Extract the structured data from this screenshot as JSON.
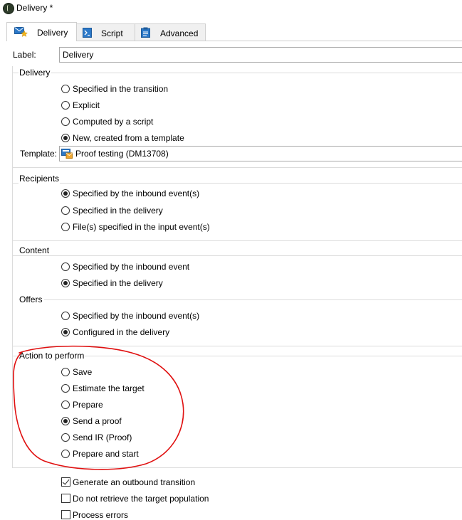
{
  "window": {
    "title": "Delivery *"
  },
  "tabs": [
    {
      "label": "Delivery",
      "icon": "delivery-envelope-icon",
      "active": true
    },
    {
      "label": "Script",
      "icon": "script-icon",
      "active": false
    },
    {
      "label": "Advanced",
      "icon": "advanced-clipboard-icon",
      "active": false
    }
  ],
  "label_field": {
    "label": "Label:",
    "value": "Delivery"
  },
  "delivery_group": {
    "title": "Delivery",
    "options": [
      {
        "label": "Specified in the transition",
        "selected": false
      },
      {
        "label": "Explicit",
        "selected": false
      },
      {
        "label": "Computed by a script",
        "selected": false
      },
      {
        "label": "New, created from a template",
        "selected": true
      }
    ],
    "template_label": "Template:",
    "template_value": "Proof testing (DM13708)"
  },
  "recipients_group": {
    "title": "Recipients",
    "options": [
      {
        "label": "Specified by the inbound event(s)",
        "selected": true
      },
      {
        "label": "Specified in the delivery",
        "selected": false
      },
      {
        "label": "File(s) specified in the input event(s)",
        "selected": false
      }
    ]
  },
  "content_group": {
    "title": "Content",
    "options": [
      {
        "label": "Specified by the inbound event",
        "selected": false
      },
      {
        "label": "Specified in the delivery",
        "selected": true
      }
    ]
  },
  "offers_group": {
    "title": "Offers",
    "options": [
      {
        "label": "Specified by the inbound event(s)",
        "selected": false
      },
      {
        "label": "Configured in the delivery",
        "selected": true
      }
    ]
  },
  "action_group": {
    "title": "Action to perform",
    "options": [
      {
        "label": "Save",
        "selected": false
      },
      {
        "label": "Estimate the target",
        "selected": false
      },
      {
        "label": "Prepare",
        "selected": false
      },
      {
        "label": "Send a proof",
        "selected": true
      },
      {
        "label": "Send IR (Proof)",
        "selected": false
      },
      {
        "label": "Prepare and start",
        "selected": false
      }
    ],
    "annotation_color": "#e01010"
  },
  "checkboxes": [
    {
      "label": "Generate an outbound transition",
      "checked": true
    },
    {
      "label": "Do not retrieve the target population",
      "checked": false
    },
    {
      "label": "Process errors",
      "checked": false
    }
  ]
}
